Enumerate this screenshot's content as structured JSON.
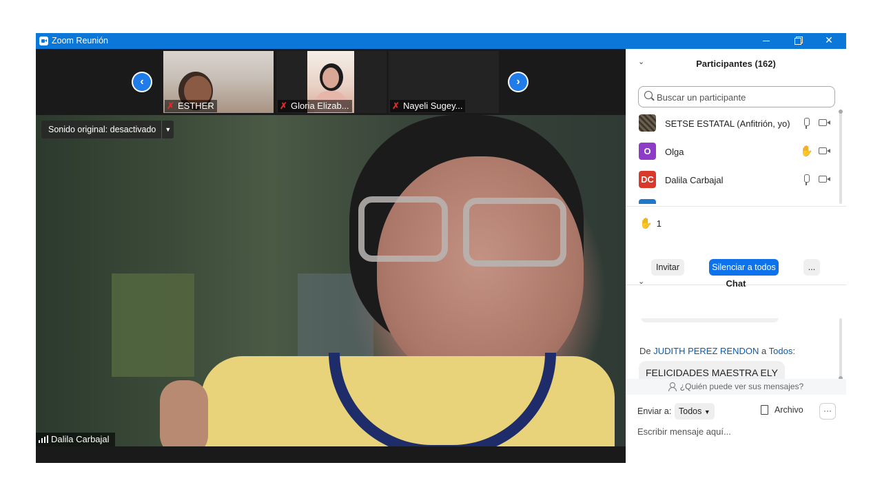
{
  "window": {
    "title": "Zoom Reunión",
    "controls": {
      "minimize": "–",
      "maximize": "❐",
      "close": "✕"
    }
  },
  "gallery": {
    "prev_arrow": "‹",
    "next_arrow": "›",
    "thumbnails": [
      {
        "name": "ESTHER",
        "muted": true
      },
      {
        "name": "Gloria Elizab...",
        "muted": true
      },
      {
        "name": "Nayeli Sugey...",
        "muted": true
      }
    ]
  },
  "main_video": {
    "audio_dropdown": "Sonido original: desactivado",
    "speaker_name": "Dalila Carbajal"
  },
  "participants": {
    "title": "Participantes (162)",
    "search_placeholder": "Buscar un participante",
    "list": [
      {
        "name": "SETSE ESTATAL (Anfitrión, yo)",
        "initials": "",
        "avatar_color": "#5a5246",
        "status_icon": "mic"
      },
      {
        "name": "Olga",
        "initials": "O",
        "avatar_color": "#8c3cc6",
        "status_icon": "raised-hand"
      },
      {
        "name": "Dalila Carbajal",
        "initials": "DC",
        "avatar_color": "#d9382b",
        "status_icon": "mic"
      }
    ],
    "raised_hands_count": "1",
    "invite_label": "Invitar",
    "mute_all_label": "Silenciar a todos",
    "more_label": "..."
  },
  "chat": {
    "title": "Chat",
    "last_message": {
      "prefix": "De",
      "sender": "JUDITH PEREZ RENDON",
      "to_word": "a",
      "recipient": "Todos:",
      "text": "FELICIDADES MAESTRA ELY"
    },
    "who_can_see": "¿Quién puede ver sus mensajes?",
    "send_to_label": "Enviar a:",
    "send_to_value": "Todos",
    "file_label": "Archivo",
    "more_label": "···",
    "input_placeholder": "Escribir mensaje aquí..."
  },
  "colors": {
    "titlebar": "#0b77d8",
    "accent_button": "#0e72ed",
    "link_blue": "#0b5cad",
    "raised_hand": "#f2b705",
    "muted_red": "#e02a2a"
  }
}
